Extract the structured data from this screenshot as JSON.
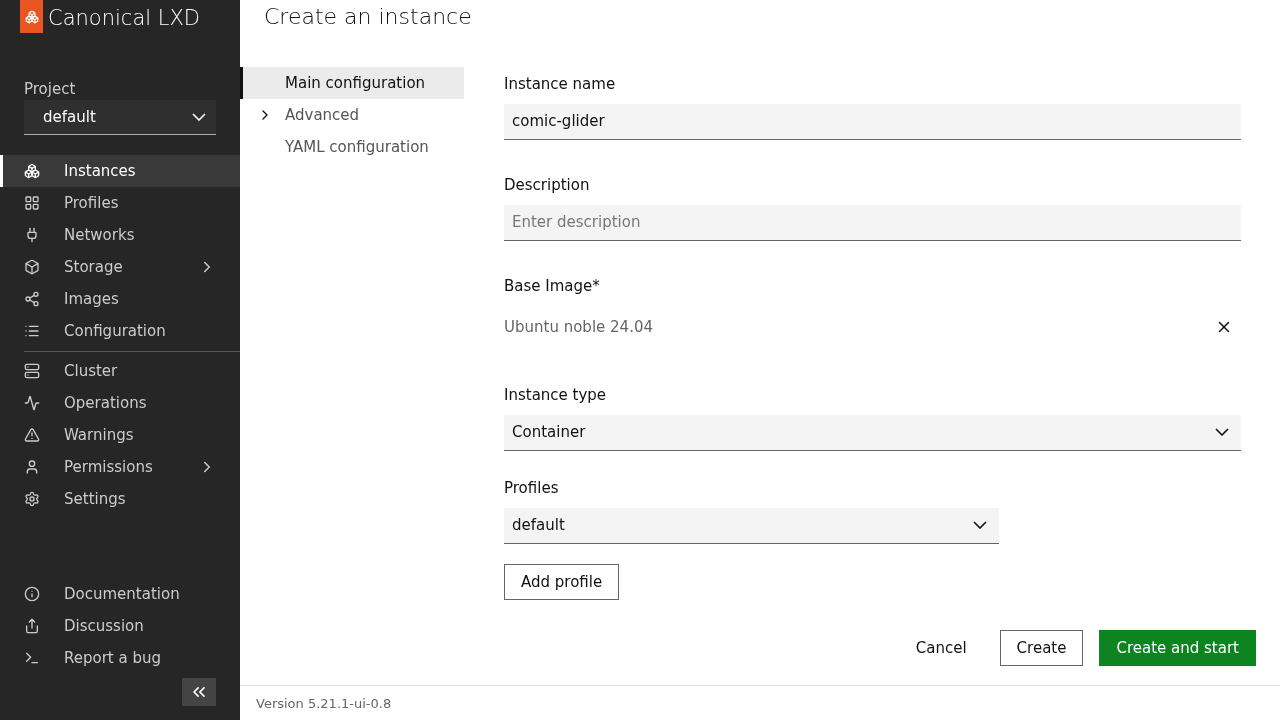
{
  "brand": {
    "name": "Canonical LXD"
  },
  "project": {
    "label": "Project",
    "value": "default"
  },
  "nav_main": [
    {
      "label": "Instances",
      "selected": true,
      "expandable": false
    },
    {
      "label": "Profiles",
      "selected": false,
      "expandable": false
    },
    {
      "label": "Networks",
      "selected": false,
      "expandable": false
    },
    {
      "label": "Storage",
      "selected": false,
      "expandable": true
    },
    {
      "label": "Images",
      "selected": false,
      "expandable": false
    },
    {
      "label": "Configuration",
      "selected": false,
      "expandable": false
    }
  ],
  "nav_admin": [
    {
      "label": "Cluster",
      "selected": false,
      "expandable": false
    },
    {
      "label": "Operations",
      "selected": false,
      "expandable": false
    },
    {
      "label": "Warnings",
      "selected": false,
      "expandable": false
    },
    {
      "label": "Permissions",
      "selected": false,
      "expandable": true
    },
    {
      "label": "Settings",
      "selected": false,
      "expandable": false
    }
  ],
  "nav_footer": [
    {
      "label": "Documentation"
    },
    {
      "label": "Discussion"
    },
    {
      "label": "Report a bug"
    }
  ],
  "page_title": "Create an instance",
  "sections": [
    {
      "label": "Main configuration",
      "selected": true,
      "expandable": false
    },
    {
      "label": "Advanced",
      "selected": false,
      "expandable": true
    },
    {
      "label": "YAML configuration",
      "selected": false,
      "expandable": false
    }
  ],
  "form": {
    "instance_name": {
      "label": "Instance name",
      "value": "comic-glider"
    },
    "description": {
      "label": "Description",
      "placeholder": "Enter description"
    },
    "base_image": {
      "label": "Base Image*",
      "value": "Ubuntu noble 24.04"
    },
    "instance_type": {
      "label": "Instance type",
      "value": "Container"
    },
    "profiles": {
      "label": "Profiles",
      "value": "default",
      "add_button": "Add profile"
    }
  },
  "actions": {
    "cancel": "Cancel",
    "create": "Create",
    "create_and_start": "Create and start"
  },
  "footer": {
    "version": "Version 5.21.1-ui-0.8"
  }
}
